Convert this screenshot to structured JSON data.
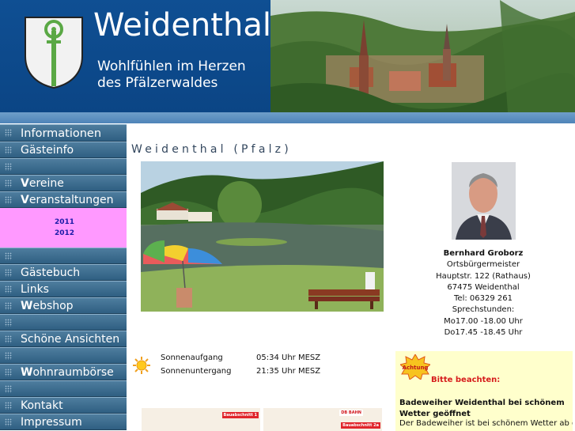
{
  "header": {
    "title": "Weidenthal",
    "slogan_line1": "Wohlfühlen im Herzen",
    "slogan_line2": "des Pfälzerwaldes",
    "logo_icon": "coat-of-arms-icon",
    "colors": {
      "header_blue": "#0d4a8a",
      "nav_blue": "#3a6a8c",
      "highlight_pink": "#ff99ff",
      "notice_yellow": "#ffffcc"
    }
  },
  "sidebar": {
    "items": [
      {
        "label": "Informationen",
        "bold_prefix": ""
      },
      {
        "label": "Gästeinfo",
        "bold_prefix": ""
      },
      {
        "label": "",
        "bold_prefix": ""
      },
      {
        "label": "ereine",
        "bold_prefix": "V"
      },
      {
        "label": "eranstaltungen",
        "bold_prefix": "V"
      },
      {
        "label": "",
        "bold_prefix": ""
      },
      {
        "label": "Gästebuch",
        "bold_prefix": ""
      },
      {
        "label": "Links",
        "bold_prefix": ""
      },
      {
        "label": "ebshop",
        "bold_prefix": "W"
      },
      {
        "label": "",
        "bold_prefix": ""
      },
      {
        "label": "Schöne Ansichten",
        "bold_prefix": ""
      },
      {
        "label": "",
        "bold_prefix": ""
      },
      {
        "label": "ohnraumbörse",
        "bold_prefix": "W"
      },
      {
        "label": "",
        "bold_prefix": ""
      },
      {
        "label": "Kontakt",
        "bold_prefix": ""
      },
      {
        "label": "Impressum",
        "bold_prefix": ""
      }
    ],
    "years": [
      "2011",
      "2012"
    ]
  },
  "main": {
    "heading": "Weidenthal (Pfalz)",
    "mayor": {
      "name": "Bernhard Groborz",
      "role": "Ortsbürgermeister",
      "address": "Hauptstr. 122 (Rathaus)",
      "city": "67475 Weidenthal",
      "phone": "Tel: 06329 261",
      "hours_title": "Sprechstunden:",
      "hours_1": "Mo17.00 -18.00 Uhr",
      "hours_2": "Do17.45 -18.45 Uhr"
    },
    "sun": {
      "icon": "sun-icon",
      "sunrise_label": "Sonnenaufgang",
      "sunrise_value": "05:34 Uhr MESZ",
      "sunset_label": "Sonnenuntergang",
      "sunset_value": "21:35 Uhr MESZ"
    },
    "notice": {
      "badge": "Achtung",
      "title": "Bitte beachten:",
      "headline": "Badeweiher Weidenthal bei schönem Wetter geöffnet",
      "text": "Der Badeweiher ist bei schönem Wetter ab der"
    },
    "banners": {
      "left_tag": "Bauabschnitt 1",
      "right_db": "DB BAHN",
      "right_tag": "Bauabschnitt 2a"
    }
  }
}
